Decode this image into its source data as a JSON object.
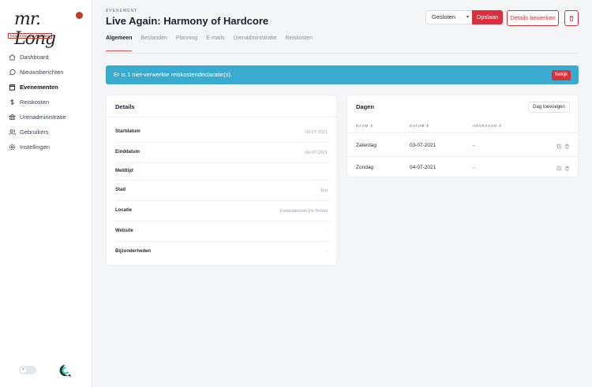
{
  "logo": {
    "script": "mr. Long",
    "tagline": "King of the disco Goldies"
  },
  "sidebar": {
    "items": [
      {
        "label": "Dashboard",
        "icon": "home-icon"
      },
      {
        "label": "Nieuwsberichten",
        "icon": "chat-bubble-icon"
      },
      {
        "label": "Evenementen",
        "icon": "calendar-icon"
      },
      {
        "label": "Reiskosten",
        "icon": "dollar-icon"
      },
      {
        "label": "Urenadministratie",
        "icon": "bank-icon"
      },
      {
        "label": "Gebruikers",
        "icon": "users-icon"
      },
      {
        "label": "Instellingen",
        "icon": "gear-icon"
      }
    ]
  },
  "header": {
    "eyebrow": "EVENEMENT",
    "title": "Live Again: Harmony of Hardcore",
    "status_select": "Gesloten",
    "save_label": "Opslaan",
    "edit_label": "Details bewerken"
  },
  "tabs": [
    "Algemeen",
    "Bestanden",
    "Planning",
    "E-mails",
    "Urenadministratie",
    "Reiskosten"
  ],
  "alert": {
    "text": "Er is 1 niet-verwerkte reiskostendeclaratie(s).",
    "button": "Bekijk"
  },
  "details": {
    "title": "Details",
    "rows": [
      {
        "label": "Startdatum",
        "value": "03-07-2021"
      },
      {
        "label": "Einddatum",
        "value": "04-07-2021"
      },
      {
        "label": "Meldtijd",
        "value": ""
      },
      {
        "label": "Stad",
        "value": "Erp"
      },
      {
        "label": "Locatie",
        "value": "Festivalterrein De Rosiet"
      },
      {
        "label": "Website",
        "value": "-"
      },
      {
        "label": "Bijzonderheden",
        "value": "-"
      }
    ]
  },
  "days": {
    "title": "Dagen",
    "add_label": "Dag toevoegen",
    "columns": [
      "NAAM ⇕",
      "DATUM ⇕",
      "GEVRAAGD ⇕"
    ],
    "rows": [
      {
        "naam": "Zaterdag",
        "datum": "03-07-2021",
        "gevraagd": "-"
      },
      {
        "naam": "Zondag",
        "datum": "04-07-2021",
        "gevraagd": "-"
      }
    ]
  },
  "colors": {
    "accent": "#dc2f3c",
    "alert": "#3aabd0"
  }
}
